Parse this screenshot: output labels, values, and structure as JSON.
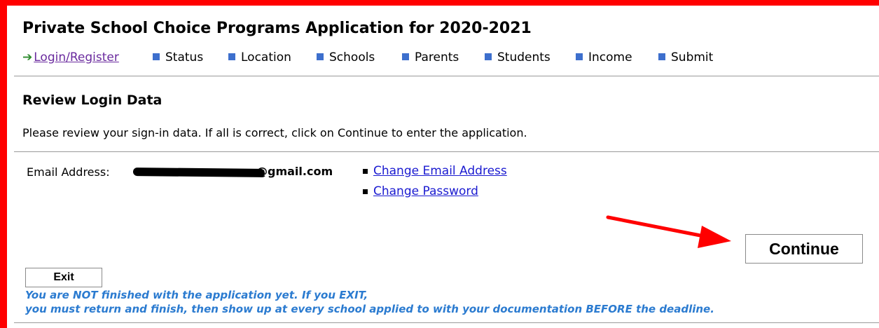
{
  "page": {
    "title": "Private School Choice Programs Application for 2020-2021"
  },
  "nav": {
    "arrow": "➔",
    "items": [
      {
        "label": "Login/Register",
        "current": true
      },
      {
        "label": "Status"
      },
      {
        "label": "Location"
      },
      {
        "label": "Schools"
      },
      {
        "label": "Parents"
      },
      {
        "label": "Students"
      },
      {
        "label": "Income"
      },
      {
        "label": "Submit"
      }
    ]
  },
  "section": {
    "title": "Review Login Data",
    "instructions": "Please review your sign-in data. If all is correct, click on Continue to enter the application."
  },
  "login": {
    "email_label": "Email Address:",
    "email_visible": "@gmail.com",
    "change_email": "Change Email Address",
    "change_password": "Change Password"
  },
  "buttons": {
    "continue": "Continue",
    "exit": "Exit"
  },
  "warning": {
    "line1": "You are NOT finished with the application yet. If you EXIT,",
    "line2": "you must return and finish, then show up at every school applied to with your documentation BEFORE the deadline."
  },
  "colors": {
    "annotation_red": "#ff0000",
    "nav_square": "#3d6fcd",
    "link": "#1a1ad0",
    "warning_text": "#2b7bd0"
  }
}
